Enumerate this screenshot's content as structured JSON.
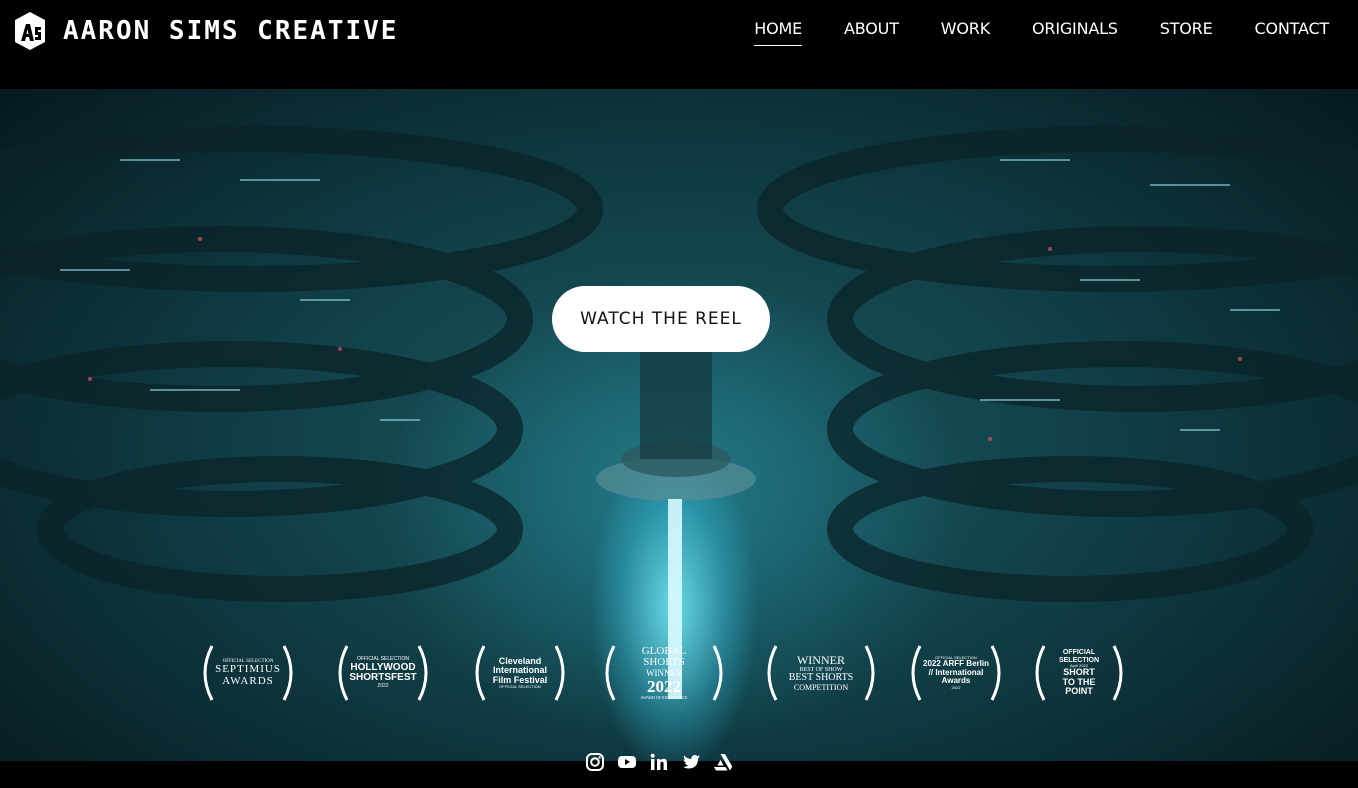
{
  "brand": {
    "name": "AARON SIMS CREATIVE",
    "logo_icon": "as-monogram-icon"
  },
  "nav": {
    "items": [
      {
        "label": "HOME",
        "active": true
      },
      {
        "label": "ABOUT"
      },
      {
        "label": "WORK"
      },
      {
        "label": "ORIGINALS"
      },
      {
        "label": "STORE"
      },
      {
        "label": "CONTACT"
      }
    ]
  },
  "hero": {
    "cta_label": "WATCH THE REEL"
  },
  "laurels": [
    {
      "line1": "OFFICIAL SELECTION",
      "line2": "SEPTIMIUS",
      "line3": "AWARDS"
    },
    {
      "line1": "OFFICIAL SELECTION",
      "line2": "HOLLYWOOD",
      "line3": "SHORTSFEST",
      "line4": "2022"
    },
    {
      "line1": "Cleveland",
      "line2": "International",
      "line3": "Film Festival",
      "line4": "OFFICIAL SELECTION"
    },
    {
      "line1": "GLOBAL",
      "line2": "SHORTS",
      "line3": "WINNER",
      "line4": "2022",
      "line5": "AWARD OF EXCELLENCE"
    },
    {
      "line1": "WINNER",
      "line2": "BEST OF SHOW",
      "line3": "BEST SHORTS",
      "line4": "COMPETITION"
    },
    {
      "line1": "OFFICIAL SELECTION",
      "line2": "2022 ARFF Berlin",
      "line3": "// International",
      "line4": "Awards",
      "line5": "2022"
    },
    {
      "line1": "OFFICIAL",
      "line2": "SELECTION",
      "line3": "April 2022",
      "line4": "SHORT",
      "line5": "TO THE",
      "line6": "POINT"
    }
  ],
  "socials": [
    "instagram-icon",
    "youtube-icon",
    "linkedin-icon",
    "twitter-icon",
    "artstation-icon"
  ]
}
